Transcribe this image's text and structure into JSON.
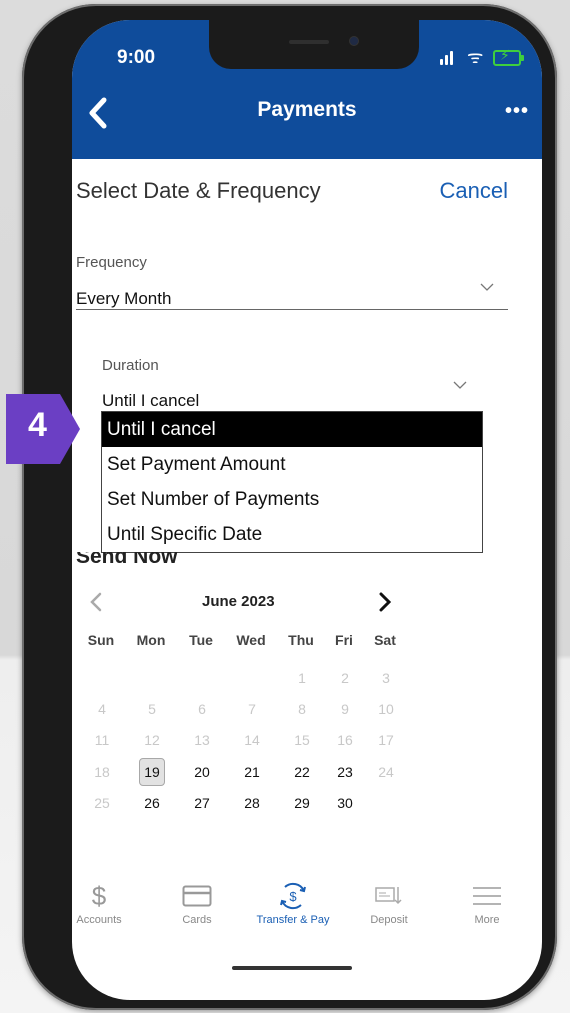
{
  "status": {
    "time": "9:00"
  },
  "header": {
    "title": "Payments",
    "more_label": "•••"
  },
  "sheet": {
    "title": "Select Date & Frequency",
    "cancel_label": "Cancel"
  },
  "frequency": {
    "label": "Frequency",
    "value": "Every Month"
  },
  "duration": {
    "label": "Duration",
    "value": "Until I cancel",
    "options": [
      "Until I cancel",
      "Set Payment Amount",
      "Set Number of Payments",
      "Until Specific Date"
    ],
    "selected_index": 0
  },
  "step_badge": "4",
  "send_now_label": "Send Now",
  "calendar": {
    "month_label": "June 2023",
    "weekdays": [
      "Sun",
      "Mon",
      "Tue",
      "Wed",
      "Thu",
      "Fri",
      "Sat"
    ],
    "weeks": [
      [
        "",
        "",
        "",
        "",
        "1",
        "2",
        "3"
      ],
      [
        "4",
        "5",
        "6",
        "7",
        "8",
        "9",
        "10"
      ],
      [
        "11",
        "12",
        "13",
        "14",
        "15",
        "16",
        "17"
      ],
      [
        "18",
        "19",
        "20",
        "21",
        "22",
        "23",
        "24"
      ],
      [
        "25",
        "26",
        "27",
        "28",
        "29",
        "30",
        ""
      ]
    ],
    "enabled_days": [
      19,
      20,
      21,
      22,
      23,
      26,
      27,
      28,
      29,
      30
    ],
    "today": "19"
  },
  "tabs": [
    {
      "label": "Accounts",
      "icon": "dollar-icon",
      "active": false
    },
    {
      "label": "Cards",
      "icon": "card-icon",
      "active": false
    },
    {
      "label": "Transfer & Pay",
      "icon": "transfer-pay-icon",
      "active": true
    },
    {
      "label": "Deposit",
      "icon": "check-deposit-icon",
      "active": false
    },
    {
      "label": "More",
      "icon": "menu-icon",
      "active": false
    }
  ],
  "colors": {
    "brand": "#0f4c9b",
    "accent": "#1a5fb4",
    "badge": "#6b3fc4"
  }
}
